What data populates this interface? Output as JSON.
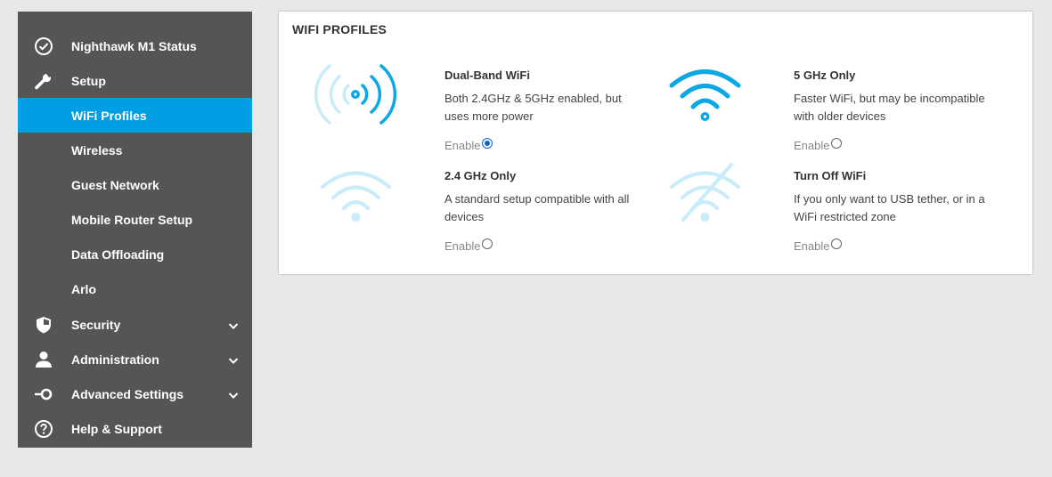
{
  "sidebar": {
    "items": [
      {
        "label": "Nighthawk M1 Status",
        "icon": "check-circle-icon"
      },
      {
        "label": "Setup",
        "icon": "wrench-icon"
      },
      {
        "label": "WiFi Profiles",
        "active": true
      },
      {
        "label": "Wireless"
      },
      {
        "label": "Guest Network"
      },
      {
        "label": "Mobile Router Setup"
      },
      {
        "label": "Data Offloading"
      },
      {
        "label": "Arlo"
      },
      {
        "label": "Security",
        "icon": "shield-icon",
        "expandable": true
      },
      {
        "label": "Administration",
        "icon": "person-icon",
        "expandable": true
      },
      {
        "label": "Advanced Settings",
        "icon": "toggle-icon",
        "expandable": true
      },
      {
        "label": "Help & Support",
        "icon": "question-circle-icon"
      }
    ]
  },
  "panel": {
    "title": "WIFI PROFILES",
    "profiles": [
      {
        "title": "Dual-Band WiFi",
        "description": "Both 2.4GHz & 5GHz enabled, but uses more power",
        "enable_label": "Enable",
        "selected": true,
        "icon": "dual-band-wifi-icon"
      },
      {
        "title": "5 GHz Only",
        "description": "Faster WiFi, but may be incompatible with older devices",
        "enable_label": "Enable",
        "selected": false,
        "icon": "wifi-5ghz-icon"
      },
      {
        "title": "2.4 GHz Only",
        "description": "A standard setup compatible with all devices",
        "enable_label": "Enable",
        "selected": false,
        "icon": "wifi-24ghz-icon"
      },
      {
        "title": "Turn Off WiFi",
        "description": "If you only want to USB tether, or in a WiFi restricted zone",
        "enable_label": "Enable",
        "selected": false,
        "icon": "wifi-off-icon"
      }
    ]
  },
  "colors": {
    "sidebar_bg": "#555555",
    "accent": "#009fe3",
    "icon_light": "#c9ecfa",
    "background": "#e8e8e8"
  }
}
